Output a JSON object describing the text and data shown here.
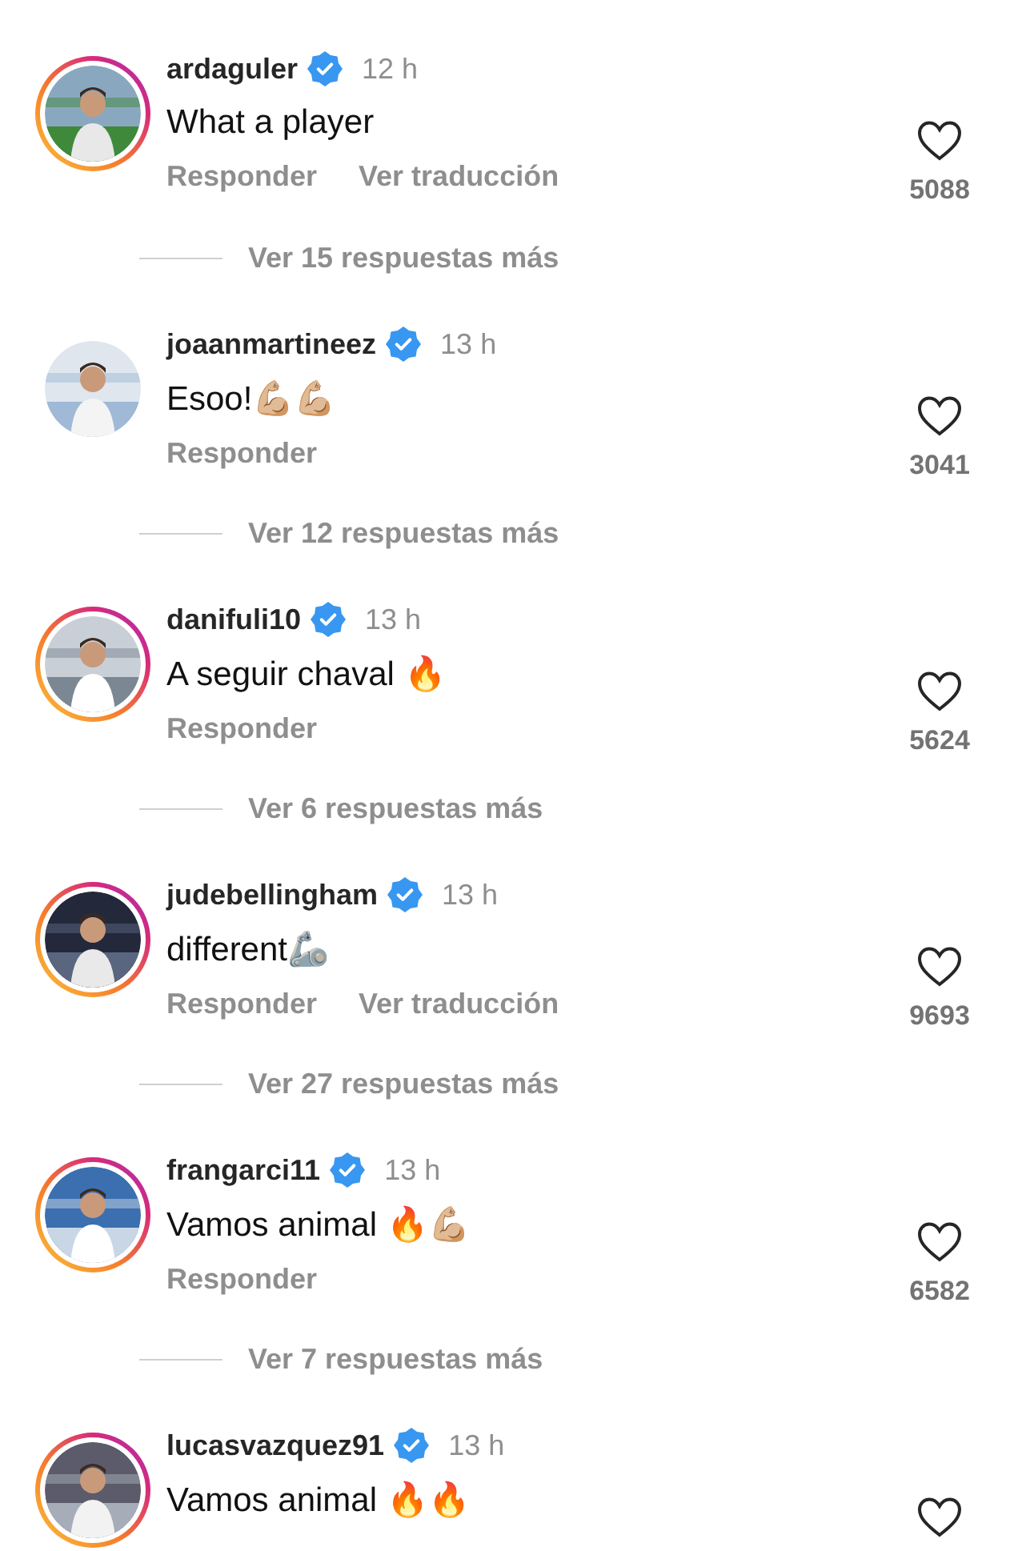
{
  "comments": [
    {
      "username": "ardaguler",
      "verified": true,
      "story_ring": true,
      "time": "12 h",
      "text": "What a player",
      "actions": [
        "Responder",
        "Ver traducción"
      ],
      "likes": "5088",
      "replies": "Ver 15 respuestas más"
    },
    {
      "username": "joaanmartineez",
      "verified": true,
      "story_ring": false,
      "time": "13 h",
      "text": "Esoo!💪🏼💪🏼",
      "actions": [
        "Responder"
      ],
      "likes": "3041",
      "replies": "Ver 12 respuestas más"
    },
    {
      "username": "danifuli10",
      "verified": true,
      "story_ring": true,
      "time": "13 h",
      "text": "A seguir chaval 🔥",
      "actions": [
        "Responder"
      ],
      "likes": "5624",
      "replies": "Ver 6 respuestas más"
    },
    {
      "username": "judebellingham",
      "verified": true,
      "story_ring": true,
      "time": "13 h",
      "text": "different🦾",
      "actions": [
        "Responder",
        "Ver traducción"
      ],
      "likes": "9693",
      "replies": "Ver 27 respuestas más"
    },
    {
      "username": "frangarci11",
      "verified": true,
      "story_ring": true,
      "time": "13 h",
      "text": "Vamos animal 🔥💪🏼",
      "actions": [
        "Responder"
      ],
      "likes": "6582",
      "replies": "Ver 7 respuestas más"
    },
    {
      "username": "lucasvazquez91",
      "verified": true,
      "story_ring": true,
      "time": "13 h",
      "text": "Vamos animal 🔥🔥"
    }
  ]
}
